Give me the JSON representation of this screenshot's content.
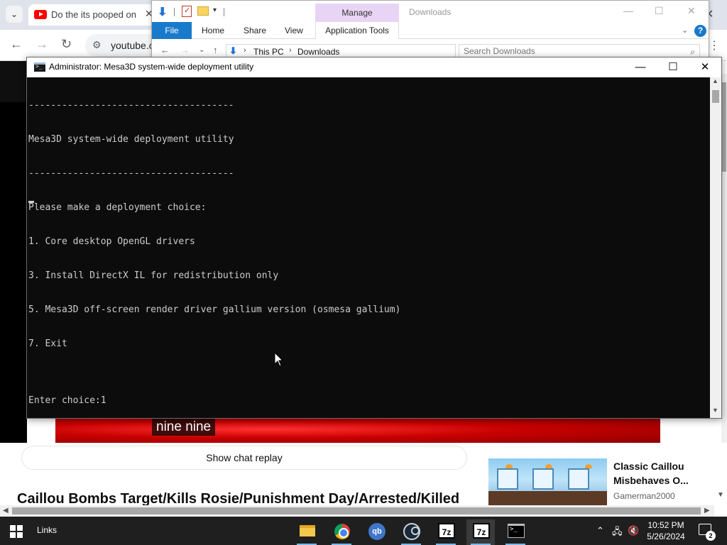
{
  "browser": {
    "tab_title": "Do the its pooped on",
    "url": "youtube.c",
    "caption": "nine nine",
    "show_chat_replay": "Show chat replay",
    "video_title": "Caillou Bombs Target/Kills Rosie/Punishment Day/Arrested/Killed",
    "recommended": {
      "title": "Classic Caillou Misbehaves O...",
      "channel": "Gamerman2000"
    }
  },
  "explorer": {
    "title": "Downloads",
    "manage_tab": "Manage",
    "ribbon_tabs": {
      "file": "File",
      "home": "Home",
      "share": "Share",
      "view": "View",
      "app_tools": "Application Tools"
    },
    "breadcrumb": [
      "This PC",
      "Downloads"
    ],
    "search_placeholder": "Search Downloads"
  },
  "console": {
    "title": "Administrator:  Mesa3D system-wide deployment utility",
    "lines": [
      "-------------------------------------",
      "Mesa3D system-wide deployment utility",
      "-------------------------------------",
      "Please make a deployment choice:",
      "1. Core desktop OpenGL drivers",
      "3. Install DirectX IL for redistribution only",
      "5. Mesa3D off-screen render driver gallium version (osmesa gallium)",
      "7. Exit",
      "",
      "Enter choice:1"
    ]
  },
  "taskbar": {
    "links_label": "Links",
    "time": "10:52 PM",
    "date": "5/26/2024",
    "notification_count": "2",
    "apps": [
      {
        "name": "file-explorer",
        "label": ""
      },
      {
        "name": "chrome",
        "label": ""
      },
      {
        "name": "qbittorrent",
        "label": "qb"
      },
      {
        "name": "steam",
        "label": ""
      },
      {
        "name": "7zip",
        "label": "7z"
      },
      {
        "name": "7zip-active",
        "label": "7z"
      },
      {
        "name": "command-prompt",
        "label": ""
      }
    ]
  },
  "colors": {
    "console_bg": "#0c0c0c",
    "console_text": "#cccccc",
    "ribbon_blue": "#1979ca",
    "manage_purple": "#e8d5f5",
    "youtube_red": "#ff0000"
  }
}
